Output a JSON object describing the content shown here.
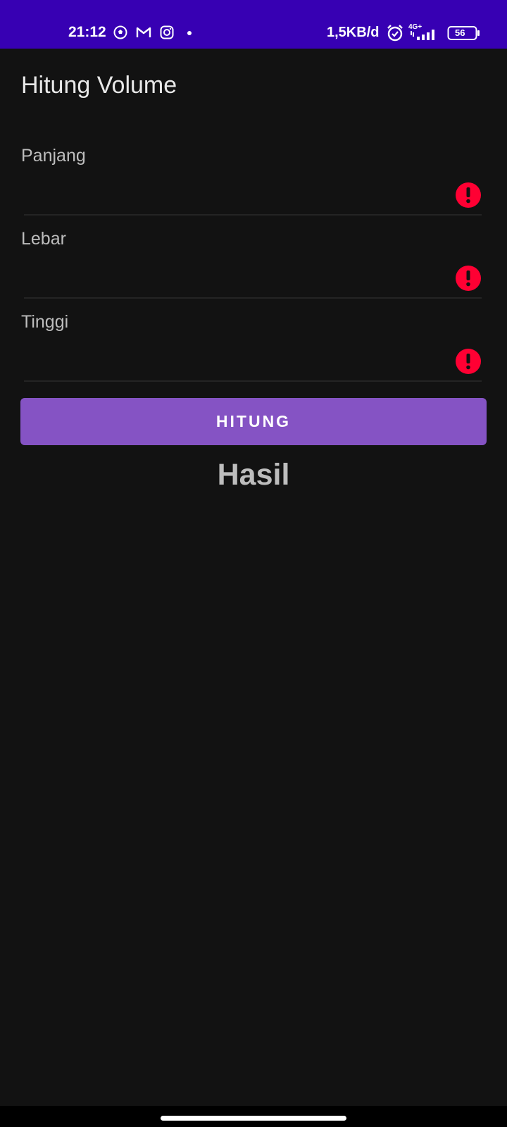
{
  "status_bar": {
    "time": "21:12",
    "network_speed": "1,5KB/d",
    "network_type": "4G+",
    "battery_level": "56",
    "icons": [
      "soccer-ball-icon",
      "gmail-icon",
      "instagram-icon",
      "notification-dot-icon",
      "alarm-icon",
      "signal-icon",
      "battery-icon"
    ]
  },
  "app": {
    "title": "Hitung Volume"
  },
  "form": {
    "fields": [
      {
        "label": "Panjang",
        "value": "",
        "error_icon": "error-icon"
      },
      {
        "label": "Lebar",
        "value": "",
        "error_icon": "error-icon"
      },
      {
        "label": "Tinggi",
        "value": "",
        "error_icon": "error-icon"
      }
    ],
    "button_label": "HITUNG"
  },
  "result": {
    "text": "Hasil"
  },
  "colors": {
    "status_bar": "#3700b3",
    "background": "#121212",
    "button": "#8553c4",
    "error": "#ff0033"
  }
}
